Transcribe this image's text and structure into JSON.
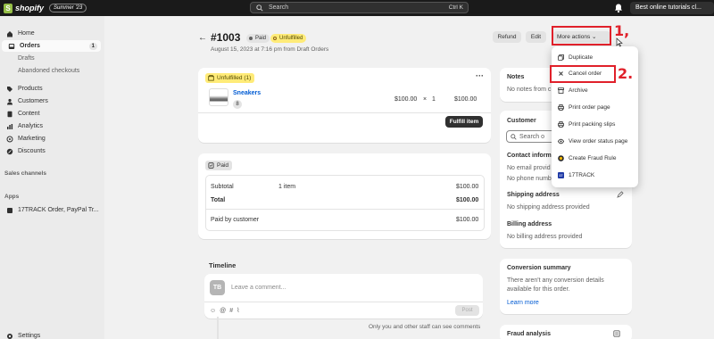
{
  "topbar": {
    "logo_text": "shopify",
    "edition": "Summer '23",
    "search_placeholder": "Search",
    "search_shortcut": "Ctrl K",
    "store_name": "Best online tutorials cl..."
  },
  "sidebar": {
    "items": [
      {
        "label": "Home"
      },
      {
        "label": "Orders",
        "badge": "1"
      },
      {
        "label": "Drafts"
      },
      {
        "label": "Abandoned checkouts"
      },
      {
        "label": "Products"
      },
      {
        "label": "Customers"
      },
      {
        "label": "Content"
      },
      {
        "label": "Analytics"
      },
      {
        "label": "Marketing"
      },
      {
        "label": "Discounts"
      }
    ],
    "sales_channels_title": "Sales channels",
    "apps_title": "Apps",
    "app_item": "17TRACK Order, PayPal Tr...",
    "settings": "Settings"
  },
  "header": {
    "order_id": "#1003",
    "paid_badge": "Paid",
    "unfulfilled_badge": "Unfulfilled",
    "subtitle": "August 15, 2023 at 7:16 pm from Draft Orders",
    "refund": "Refund",
    "edit": "Edit",
    "more_actions": "More actions"
  },
  "fulfillment_card": {
    "tag": "Unfulfilled (1)",
    "product_name": "Sneakers",
    "product_qty_chip": "8",
    "unit_price": "$100.00",
    "times": "×",
    "quantity": "1",
    "line_total": "$100.00",
    "fulfill_button": "Fulfill item"
  },
  "payment_card": {
    "tag": "Paid",
    "subtotal_label": "Subtotal",
    "subtotal_items": "1 item",
    "subtotal_value": "$100.00",
    "total_label": "Total",
    "total_value": "$100.00",
    "paid_label": "Paid by customer",
    "paid_value": "$100.00"
  },
  "timeline": {
    "title": "Timeline",
    "avatar": "TB",
    "comment_placeholder": "Leave a comment...",
    "post": "Post",
    "note": "Only you and other staff can see comments"
  },
  "notes_card": {
    "title": "Notes",
    "text": "No notes from c"
  },
  "customer_card": {
    "title": "Customer",
    "search_placeholder": "Search o",
    "contact_title": "Contact informa",
    "email": "No email provid",
    "phone": "No phone numb",
    "shipping_title": "Shipping address",
    "shipping_text": "No shipping address provided",
    "billing_title": "Billing address",
    "billing_text": "No billing address provided"
  },
  "conversion_card": {
    "title": "Conversion summary",
    "text_line1": "There aren't any conversion details",
    "text_line2": "available for this order.",
    "link": "Learn more"
  },
  "fraud_card": {
    "title": "Fraud analysis"
  },
  "dropdown": {
    "items": [
      {
        "label": "Duplicate",
        "icon": "duplicate-icon"
      },
      {
        "label": "Cancel order",
        "icon": "close-icon"
      },
      {
        "label": "Archive",
        "icon": "archive-icon"
      },
      {
        "label": "Print order page",
        "icon": "printer-icon"
      },
      {
        "label": "Print packing slips",
        "icon": "printer-icon"
      },
      {
        "label": "View order status page",
        "icon": "eye-icon"
      },
      {
        "label": "Create Fraud Rule",
        "icon": "fraud-app-icon"
      },
      {
        "label": "17TRACK",
        "icon": "17track-app-icon"
      }
    ]
  },
  "annotations": {
    "step1": "1,",
    "step2": "2."
  },
  "colors": {
    "accent_link": "#005bd3",
    "annotation_red": "#e0202a",
    "unfulfilled_yellow": "#ffeb78",
    "topbar": "#1a1a1a"
  }
}
